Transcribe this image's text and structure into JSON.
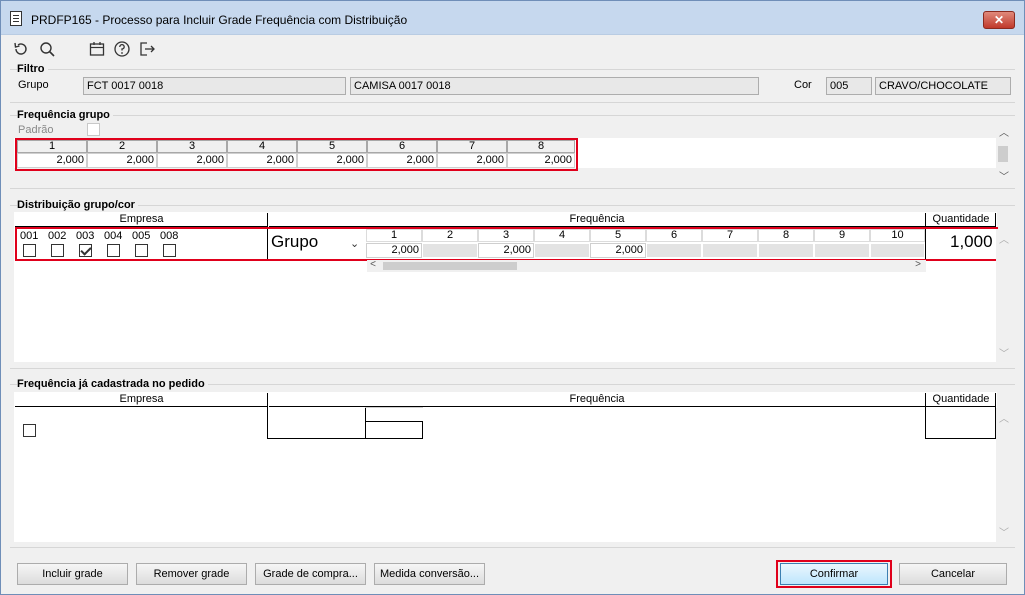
{
  "window": {
    "title": "PRDFP165 - Processo para Incluir Grade Frequência com Distribuição",
    "close_label": "✕"
  },
  "toolbar": {
    "icons": [
      "refresh-icon",
      "search-icon",
      "calendar-icon",
      "help-icon",
      "exit-icon"
    ]
  },
  "filtro": {
    "label": "Filtro",
    "grupo_label": "Grupo",
    "grupo_code": "FCT 0017 0018",
    "grupo_desc": "CAMISA 0017 0018",
    "cor_label": "Cor",
    "cor_code": "005",
    "cor_desc": "CRAVO/CHOCOLATE"
  },
  "frequencia_grupo": {
    "label": "Frequência grupo",
    "padrao_label": "Padrão",
    "headers": [
      "1",
      "2",
      "3",
      "4",
      "5",
      "6",
      "7",
      "8"
    ],
    "values": [
      "2,000",
      "2,000",
      "2,000",
      "2,000",
      "2,000",
      "2,000",
      "2,000",
      "2,000"
    ]
  },
  "distribuicao": {
    "label": "Distribuição grupo/cor",
    "col_empresa": "Empresa",
    "col_frequencia": "Frequência",
    "col_quantidade": "Quantidade",
    "empresas": [
      {
        "code": "001",
        "checked": false
      },
      {
        "code": "002",
        "checked": false
      },
      {
        "code": "003",
        "checked": true
      },
      {
        "code": "004",
        "checked": false
      },
      {
        "code": "005",
        "checked": false
      },
      {
        "code": "008",
        "checked": false
      }
    ],
    "mode_select": "Grupo",
    "freq_headers": [
      "1",
      "2",
      "3",
      "4",
      "5",
      "6",
      "7",
      "8",
      "9",
      "10"
    ],
    "freq_values": [
      "2,000",
      "",
      "2,000",
      "",
      "2,000",
      "",
      "",
      "",
      "",
      ""
    ],
    "quantidade": "1,000"
  },
  "frequencia_cadastrada": {
    "label": "Frequência já cadastrada no pedido",
    "col_empresa": "Empresa",
    "col_frequencia": "Frequência",
    "col_quantidade": "Quantidade"
  },
  "buttons": {
    "incluir_grade": "Incluir grade",
    "remover_grade": "Remover grade",
    "grade_compra": "Grade de compra...",
    "medida_conversao": "Medida conversão...",
    "confirmar": "Confirmar",
    "cancelar": "Cancelar"
  }
}
